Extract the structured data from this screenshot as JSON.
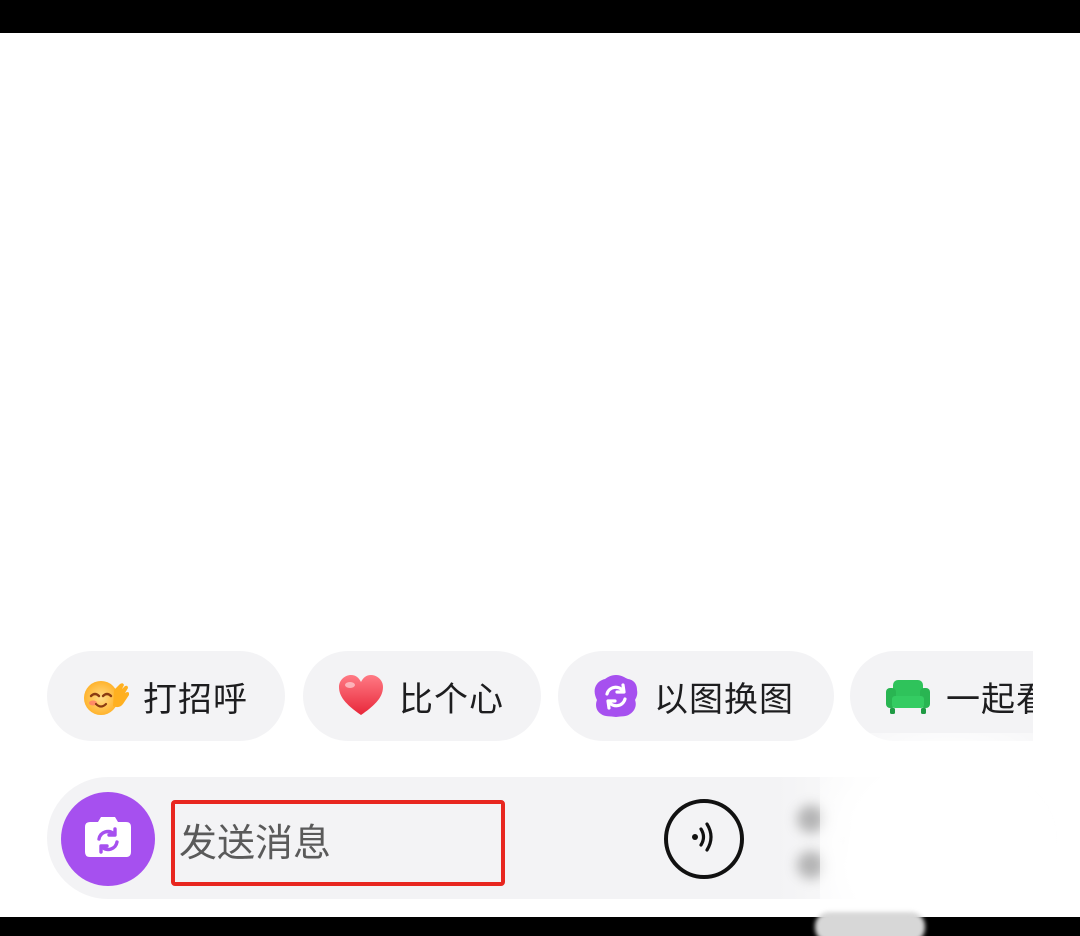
{
  "quick_replies": [
    {
      "label": "打招呼",
      "icon": "waving-smiley-icon"
    },
    {
      "label": "比个心",
      "icon": "heart-icon"
    },
    {
      "label": "以图换图",
      "icon": "photo-swap-icon"
    },
    {
      "label": "一起看",
      "icon": "sofa-icon"
    }
  ],
  "input_bar": {
    "camera_icon": "camera-refresh-icon",
    "placeholder": "发送消息",
    "voice_icon": "voice-icon"
  },
  "colors": {
    "accent_purple": "#a650ef",
    "highlight_red": "#e8261f",
    "chip_bg": "#f3f3f5",
    "sofa_green": "#2fc35b",
    "heart_red": "#f04a56"
  }
}
